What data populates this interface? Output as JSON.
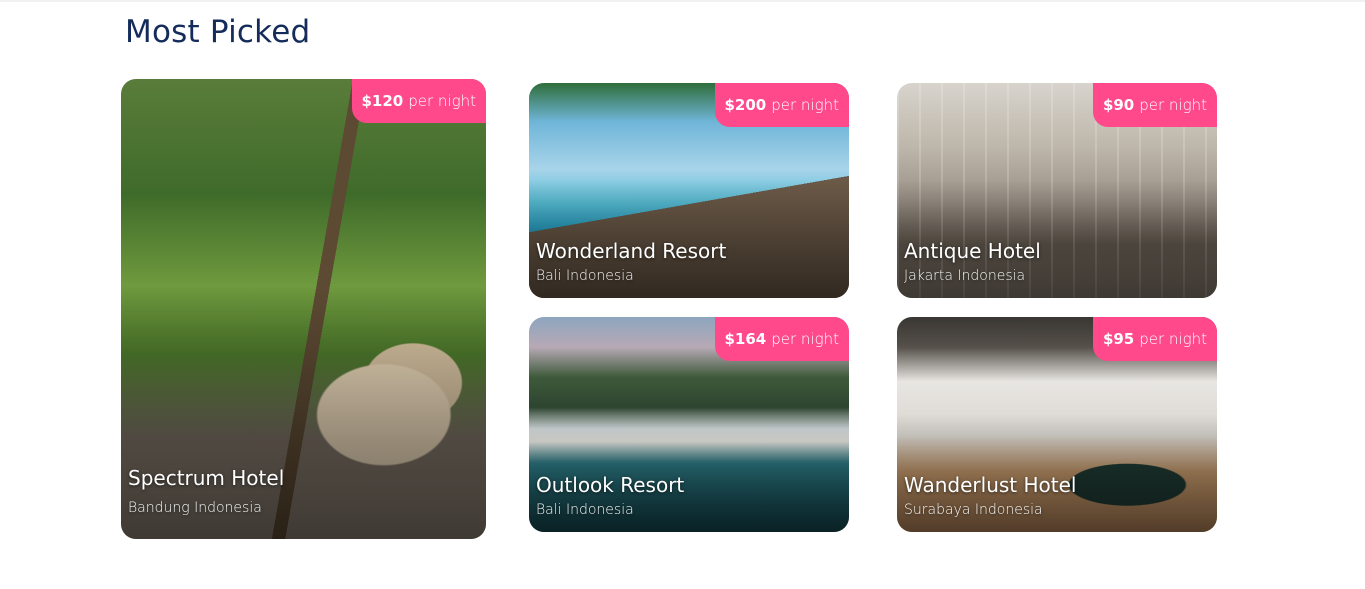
{
  "section": {
    "title": "Most Picked"
  },
  "cards": [
    {
      "price": "$120",
      "unit": "per night",
      "name": "Spectrum Hotel",
      "location": "Bandung Indonesia",
      "image": "garden-lounge-photo"
    },
    {
      "price": "$200",
      "unit": "per night",
      "name": "Wonderland Resort",
      "location": "Bali Indonesia",
      "image": "beach-pool-photo"
    },
    {
      "price": "$90",
      "unit": "per night",
      "name": "Antique Hotel",
      "location": "Jakarta Indonesia",
      "image": "hotel-lobby-photo"
    },
    {
      "price": "$164",
      "unit": "per night",
      "name": "Outlook Resort",
      "location": "Bali Indonesia",
      "image": "resort-pool-photo"
    },
    {
      "price": "$95",
      "unit": "per night",
      "name": "Wanderlust Hotel",
      "location": "Surabaya Indonesia",
      "image": "office-lounge-photo"
    }
  ],
  "colors": {
    "title": "#152c5b",
    "badge": "#ff498b",
    "card_text": "#ffffff"
  }
}
